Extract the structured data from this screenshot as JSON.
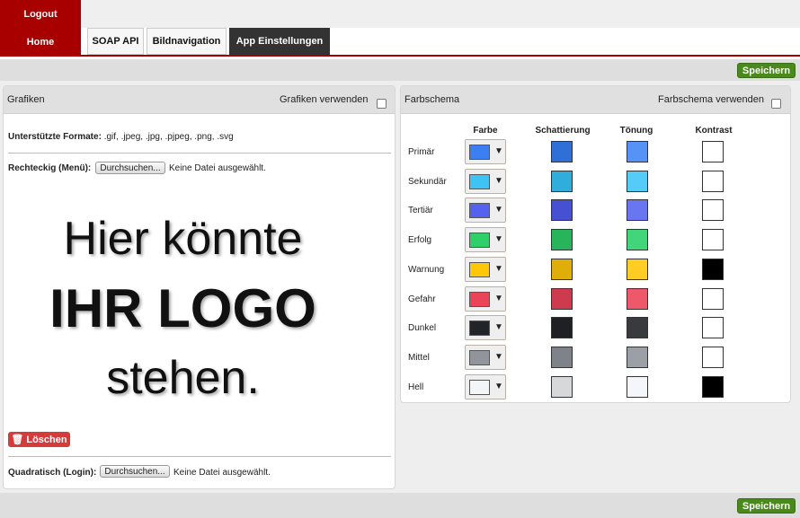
{
  "nav": {
    "logout": "Logout",
    "home": "Home",
    "tabs": [
      "SOAP API",
      "Bildnavigation",
      "App Einstellungen"
    ]
  },
  "save_label": "Speichern",
  "grafiken": {
    "title": "Grafiken",
    "use_label": "Grafiken verwenden",
    "formats_label": "Unterstützte Formate:",
    "formats_value": ".gif, .jpeg, .jpg, .pjpeg, .png, .svg",
    "rect_label": "Rechteckig (Menü):",
    "browse": "Durchsuchen...",
    "no_file": "Keine Datei ausgewählt.",
    "logo_lines": [
      "Hier könnte",
      "IHR LOGO",
      "stehen."
    ],
    "delete": "Löschen",
    "square_label": "Quadratisch (Login):"
  },
  "farbschema": {
    "title": "Farbschema",
    "use_label": "Farbschema verwenden",
    "columns": [
      "Farbe",
      "Schattierung",
      "Tönung",
      "Kontrast"
    ],
    "rows": [
      {
        "label": "Primär",
        "colors": [
          "#3b7ff2",
          "#2f6fd8",
          "#5793f6",
          "#ffffff"
        ]
      },
      {
        "label": "Sekundär",
        "colors": [
          "#3ec3f5",
          "#2faedc",
          "#54ccf7",
          "#ffffff"
        ]
      },
      {
        "label": "Tertiär",
        "colors": [
          "#5562ee",
          "#4550d3",
          "#6a75f2",
          "#ffffff"
        ]
      },
      {
        "label": "Erfolg",
        "colors": [
          "#2fcf69",
          "#27b45b",
          "#43d57a",
          "#ffffff"
        ]
      },
      {
        "label": "Warnung",
        "colors": [
          "#ffc70a",
          "#e0ae08",
          "#ffcd23",
          "#000000"
        ]
      },
      {
        "label": "Gefahr",
        "colors": [
          "#eb4459",
          "#cf3b4e",
          "#ed596b",
          "#ffffff"
        ]
      },
      {
        "label": "Dunkel",
        "colors": [
          "#222428",
          "#1e2024",
          "#383a3e",
          "#ffffff"
        ]
      },
      {
        "label": "Mittel",
        "colors": [
          "#92949c",
          "#808289",
          "#9d9fa6",
          "#ffffff"
        ]
      },
      {
        "label": "Hell",
        "colors": [
          "#f4f5f8",
          "#d7d8da",
          "#f5f6f9",
          "#000000"
        ]
      }
    ]
  }
}
